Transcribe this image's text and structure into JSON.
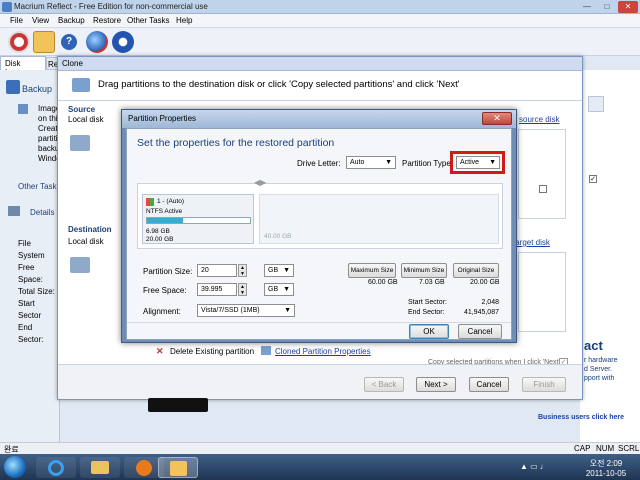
{
  "window": {
    "title": "Macrium Reflect - Free Edition for non-commercial use"
  },
  "menu": [
    "File",
    "View",
    "Backup",
    "Restore",
    "Other Tasks",
    "Help"
  ],
  "toolbar": {
    "icons": [
      "backup-icon",
      "restore-icon",
      "help-icon",
      "web-icon",
      "shop-icon"
    ]
  },
  "left_tabs": [
    "Disk Image",
    "Re"
  ],
  "left_panel": {
    "backup_heading": "Backup",
    "backup_lines": [
      "Image",
      "on thi",
      "Create",
      "partiti",
      "backu",
      "Windo"
    ],
    "other_tasks": "Other Task",
    "details": "Details",
    "detail_labels": [
      "File System",
      "Free Space:",
      "Total Size:",
      "Start Sector",
      "End Sector:"
    ]
  },
  "right_panel": {
    "lines": [
      "act",
      "r hardware",
      "d Server.",
      "pport with"
    ],
    "business": "Business users click here"
  },
  "clone": {
    "tab": "Clone",
    "banner": "Drag partitions to the destination disk or click 'Copy selected partitions' and click 'Next'",
    "source_label": "Source",
    "source_disk": "Local disk",
    "source_link": "source disk",
    "dest_label": "Destination",
    "dest_disk": "Local disk",
    "dest_link": "target disk",
    "delete_existing": "Delete Existing partition",
    "cloned_props": "Cloned Partition Properties",
    "copy_note": "Copy selected partitions when I click 'Next'",
    "back": "< Back",
    "next": "Next >",
    "cancel": "Cancel",
    "finish": "Finish"
  },
  "props": {
    "title": "Partition Properties",
    "heading": "Set the properties for the restored partition",
    "drive_letter_label": "Drive Letter:",
    "drive_letter": "Auto",
    "partition_type_label": "Partition Type:",
    "partition_type": "Active",
    "block": {
      "name": "1 - (Auto)",
      "fs": "NTFS Active",
      "used": "6.98 GB",
      "size": "20.00 GB",
      "used_fraction": 0.35,
      "free_label": "40.00 GB"
    },
    "partition_size_label": "Partition Size:",
    "partition_size": "20",
    "free_space_label": "Free Space:",
    "free_space": "39.995",
    "unit1": "GB",
    "unit2": "GB",
    "alignment_label": "Alignment:",
    "alignment": "Vista/7/SSD (1MB)",
    "max_btn": "Maximum Size",
    "min_btn": "Minimum Size",
    "orig_btn": "Original Size",
    "max_val": "60.00 GB",
    "min_val": "7.03 GB",
    "orig_val": "20.00 GB",
    "start_label": "Start Sector:",
    "start_val": "2,048",
    "end_label": "End Sector:",
    "end_val": "41,945,087",
    "ok": "OK",
    "cancel": "Cancel"
  },
  "status": {
    "left": "완료",
    "caps": "CAP",
    "num": "NUM",
    "scrl": "SCRL"
  },
  "taskbar": {
    "time": "오전 2:09",
    "date": "2011-10-05"
  }
}
